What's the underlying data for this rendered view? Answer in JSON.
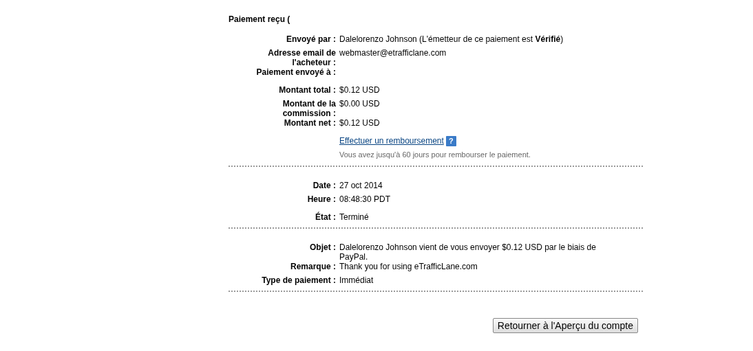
{
  "title": "Paiement reçu (",
  "sections": [
    {
      "groups": [
        {
          "rows": [
            {
              "label": "Envoyé par :",
              "value": "Dalelorenzo Johnson (L'émetteur de ce paiement est **Vérifié**)"
            },
            {
              "label": "Adresse email de l'acheteur :",
              "value": "webmaster@etrafficlane.com"
            },
            {
              "label": "Paiement envoyé à :"
            }
          ]
        },
        {
          "rows": [
            {
              "label": "Montant total :",
              "value": "$0.12 USD"
            },
            {
              "label": "Montant de la commission :",
              "value": "$0.00 USD"
            },
            {
              "label": "Montant net :",
              "value": "$0.12 USD"
            }
          ]
        }
      ],
      "refund": {
        "link": "Effectuer un remboursement",
        "help": "?",
        "note": "Vous avez jusqu'à 60 jours pour rembourser le paiement."
      }
    },
    {
      "groups": [
        {
          "rows": [
            {
              "label": "Date :",
              "value": "27 oct 2014"
            },
            {
              "label": "Heure :",
              "value": "08:48:30 PDT"
            }
          ]
        },
        {
          "rows": [
            {
              "label": "État :",
              "value": "Terminé"
            }
          ]
        }
      ]
    },
    {
      "groups": [
        {
          "rows": [
            {
              "label": "Objet :",
              "value": "Dalelorenzo Johnson vient de vous envoyer $0.12 USD par le biais de PayPal."
            },
            {
              "label": "Remarque :",
              "value": "Thank you for using eTrafficLane.com"
            },
            {
              "label": "Type de paiement :",
              "value": "Immédiat"
            }
          ]
        }
      ]
    }
  ],
  "button": "Retourner à l'Aperçu du compte"
}
